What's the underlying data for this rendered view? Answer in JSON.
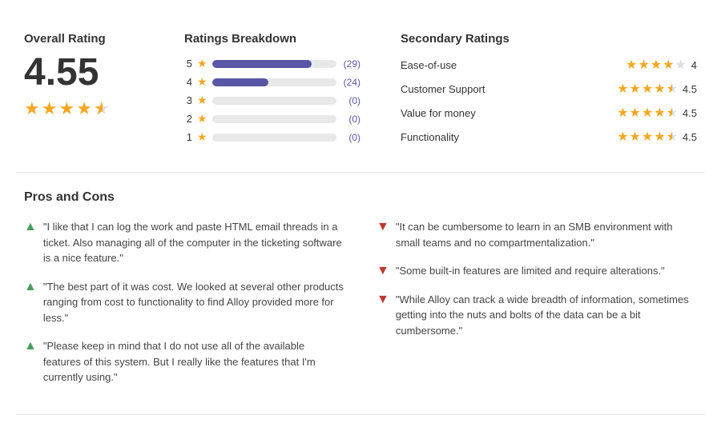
{
  "overall": {
    "title": "Overall Rating",
    "score": "4.55",
    "stars": [
      {
        "type": "full"
      },
      {
        "type": "full"
      },
      {
        "type": "full"
      },
      {
        "type": "full"
      },
      {
        "type": "half"
      }
    ]
  },
  "breakdown": {
    "title": "Ratings Breakdown",
    "bars": [
      {
        "label": "5",
        "count": "(29)",
        "fill": "bar-fill-5"
      },
      {
        "label": "4",
        "count": "(24)",
        "fill": "bar-fill-4"
      },
      {
        "label": "3",
        "count": "(0)",
        "fill": "bar-fill-3"
      },
      {
        "label": "2",
        "count": "(0)",
        "fill": "bar-fill-2"
      },
      {
        "label": "1",
        "count": "(0)",
        "fill": "bar-fill-1"
      }
    ]
  },
  "secondary": {
    "title": "Secondary Ratings",
    "items": [
      {
        "label": "Ease-of-use",
        "score": "4",
        "stars": [
          "full",
          "full",
          "full",
          "full",
          "empty"
        ]
      },
      {
        "label": "Customer Support",
        "score": "4.5",
        "stars": [
          "full",
          "full",
          "full",
          "full",
          "half"
        ]
      },
      {
        "label": "Value for money",
        "score": "4.5",
        "stars": [
          "full",
          "full",
          "full",
          "full",
          "half"
        ]
      },
      {
        "label": "Functionality",
        "score": "4.5",
        "stars": [
          "full",
          "full",
          "full",
          "full",
          "half"
        ]
      }
    ]
  },
  "proscons": {
    "title": "Pros and Cons",
    "pros": [
      {
        "text": "\"I like that I can log the work and paste HTML email threads in a ticket. Also managing all of the computer in the ticketing software is a nice feature.\""
      },
      {
        "text": "\"The best part of it was cost. We looked at several other products ranging from cost to functionality to find Alloy provided more for less.\""
      },
      {
        "text": "\"Please keep in mind that I do not use all of the available features of this system. But I really like the features that I'm currently using.\""
      }
    ],
    "cons": [
      {
        "text": "\"It can be cumbersome to learn in an SMB environment with small teams and no compartmentalization.\""
      },
      {
        "text": "\"Some built-in features are limited and require alterations.\""
      },
      {
        "text": "\"While Alloy can track a wide breadth of information, sometimes getting into the nuts and bolts of the data can be a bit cumbersome.\""
      }
    ]
  }
}
